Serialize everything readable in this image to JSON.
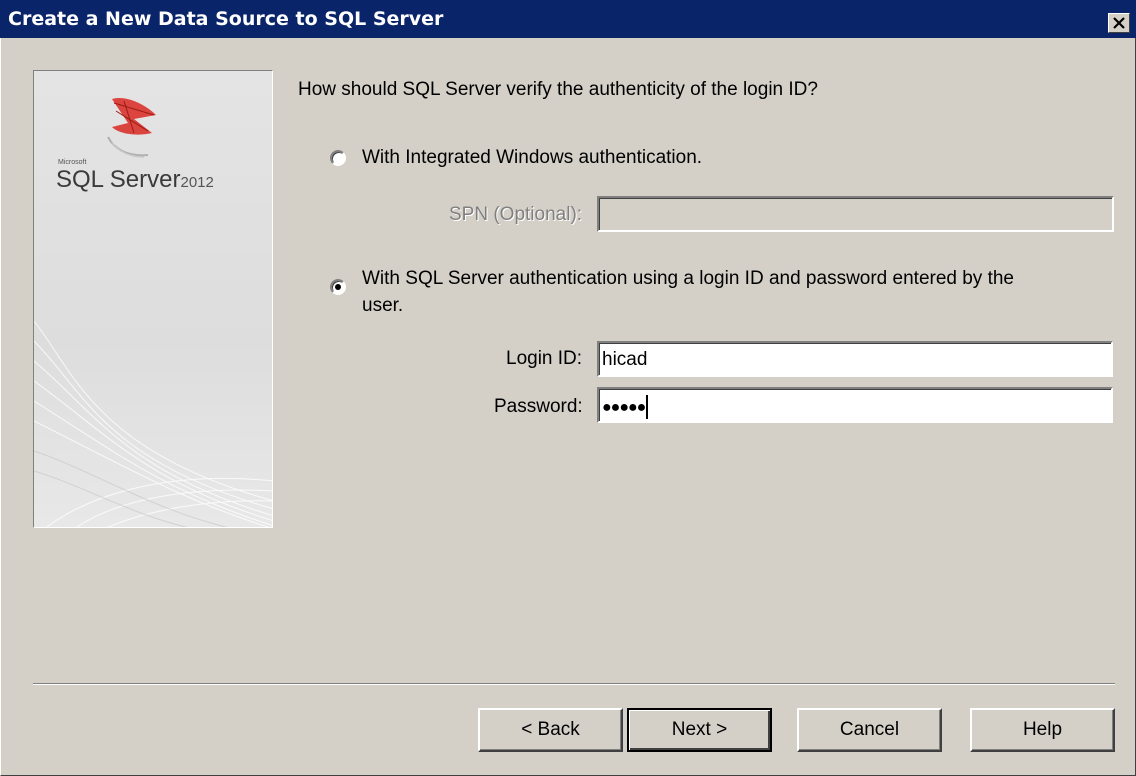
{
  "window": {
    "title": "Create a New Data Source to SQL Server"
  },
  "logo": {
    "brand": "Microsoft",
    "product": "SQL Server",
    "version": "2012"
  },
  "form": {
    "question": "How should SQL Server verify the authenticity of the login ID?",
    "option_windows": {
      "label": "With Integrated Windows authentication.",
      "selected": false
    },
    "spn": {
      "label": "SPN (Optional):",
      "value": ""
    },
    "option_sql": {
      "label_line1": "With SQL Server authentication using a login ID and password entered by the",
      "label_line2": "user.",
      "selected": true
    },
    "login": {
      "label": "Login ID:",
      "value": "hicad"
    },
    "password": {
      "label": "Password:",
      "value": "●●●●●"
    }
  },
  "buttons": {
    "back": "< Back",
    "next": "Next >",
    "cancel": "Cancel",
    "help": "Help"
  },
  "colors": {
    "titlebar": "#0a246a",
    "dialog_bg": "#d4d0c8",
    "logo_red": "#d9322c"
  }
}
